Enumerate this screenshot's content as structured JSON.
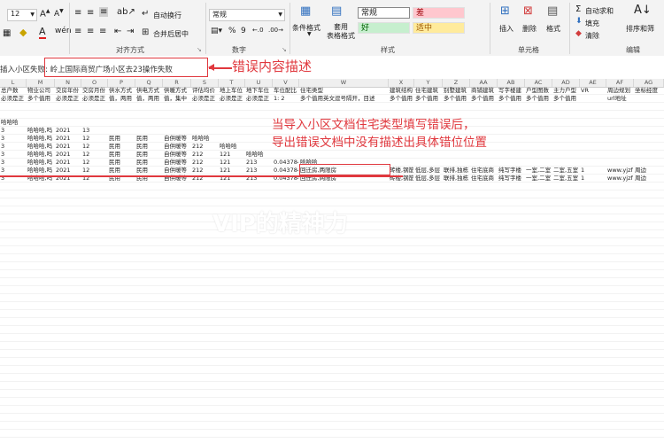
{
  "ribbon": {
    "font_size": "12",
    "align_group_label": "对齐方式",
    "wrap_text_label": "自动换行",
    "merge_center_label": "合并后居中",
    "number_group_label": "数字",
    "number_format_value": "常规",
    "conditional_format_label": "条件格式",
    "format_as_table_label": "套用\n表格格式",
    "styles_group_label": "样式",
    "cell_styles": [
      {
        "label": "常规",
        "bg": "#ffffff",
        "fg": "#222222"
      },
      {
        "label": "差",
        "bg": "#ffc7ce",
        "fg": "#9c0006"
      },
      {
        "label": "好",
        "bg": "#c6efce",
        "fg": "#006100"
      },
      {
        "label": "适中",
        "bg": "#ffeb9c",
        "fg": "#9c5700"
      }
    ],
    "insert_label": "插入",
    "delete_label": "删除",
    "format_label": "格式",
    "cells_group_label": "单元格",
    "autosum_label": "自动求和",
    "fill_label": "填充",
    "clear_label": "清除",
    "sort_filter_label": "排序和筛",
    "editing_group_label": "编辑"
  },
  "formula_bar": {
    "content": "插入小区失败: 岭上国际商贸广场小区去23操作失败"
  },
  "annotations": {
    "error_content_label": "错误内容描述",
    "note_line1": "当导入小区文档住宅类型填写错误后，",
    "note_line2": "导出错误文档中没有描述出具体错位位置",
    "watermark": "VIP的精神力"
  },
  "columns": [
    "L",
    "M",
    "N",
    "O",
    "P",
    "Q",
    "R",
    "S",
    "T",
    "U",
    "V",
    "W",
    "X",
    "Y",
    "Z",
    "AA",
    "AB",
    "AC",
    "AD",
    "AE",
    "AF",
    "AG"
  ],
  "header_row": [
    "总户数",
    "物业公司",
    "交房年份",
    "交房月份",
    "供水方式",
    "供电方式",
    "供暖方式",
    "评估均价",
    "地上车位",
    "地下车位",
    "车位配比",
    "住宅类型",
    "建筑结构",
    "住宅建筑",
    "别墅建筑",
    "商铺建筑",
    "写字楼建",
    "户型图数",
    "主力户型",
    "VR",
    "周边规划",
    "坐标经度"
  ],
  "hint_row": [
    "必须是正",
    "多个值用",
    "必须是正",
    "必须是正",
    "值，两用",
    "值，两用",
    "值，集中",
    "必须是正",
    "必须是正",
    "必须是正",
    "1: 2",
    "多个值用英文逗号隔开，目述",
    "多个值用",
    "多个值用",
    "多个值用",
    "多个值用",
    "多个值用",
    "多个值用",
    "多个值用",
    "",
    "url地址",
    ""
  ],
  "data_rows": [
    [
      "哈哈哈",
      "",
      "",
      "",
      "",
      "",
      "",
      "",
      "",
      "",
      "",
      "",
      "",
      "",
      "",
      "",
      "",
      "",
      "",
      "",
      "",
      ""
    ],
    [
      "3",
      "哈哈哈,吗",
      "2021",
      "13",
      "",
      "",
      "",
      "",
      "",
      "",
      "",
      "",
      "",
      "",
      "",
      "",
      "",
      "",
      "",
      "",
      "",
      ""
    ],
    [
      "3",
      "哈哈哈,吗",
      "2021",
      "12",
      "民用",
      "民用",
      "自供暖等",
      "哈哈哈",
      "",
      "",
      "",
      "",
      "",
      "",
      "",
      "",
      "",
      "",
      "",
      "",
      "",
      ""
    ],
    [
      "3",
      "哈哈哈,吗",
      "2021",
      "12",
      "民用",
      "民用",
      "自供暖等",
      "212",
      "哈哈哈",
      "",
      "",
      "",
      "",
      "",
      "",
      "",
      "",
      "",
      "",
      "",
      "",
      ""
    ],
    [
      "3",
      "哈哈哈,吗",
      "2021",
      "12",
      "民用",
      "民用",
      "自供暖等",
      "212",
      "121",
      "哈哈哈",
      "",
      "",
      "",
      "",
      "",
      "",
      "",
      "",
      "",
      "",
      "",
      ""
    ],
    [
      "3",
      "哈哈哈,吗",
      "2021",
      "12",
      "民用",
      "民用",
      "自供暖等",
      "212",
      "121",
      "213",
      "0.043784",
      "哈哈哈",
      "",
      "",
      "",
      "",
      "",
      "",
      "",
      "",
      "",
      ""
    ],
    [
      "3",
      "哈哈哈,吗",
      "2021",
      "12",
      "民用",
      "民用",
      "自供暖等",
      "212",
      "121",
      "213",
      "0.043784",
      "回迁房,两限房",
      "砖楼,钢筋",
      "低层,多层",
      "联排,独栋",
      "住宅底商",
      "纯写字楼",
      "一室,二室",
      "二室,五室",
      "1",
      "www.yjzf",
      "周边"
    ],
    [
      "3",
      "哈哈哈,吗",
      "2021",
      "12",
      "民用",
      "民用",
      "自供暖等",
      "212",
      "121",
      "213",
      "0.043784",
      "回迁房,两限房",
      "砖楼,钢筋",
      "低层,多层",
      "联排,独栋",
      "住宅底商",
      "纯写字楼",
      "一室,二室",
      "二室,五室",
      "1",
      "www.yjzf",
      "周边"
    ]
  ]
}
